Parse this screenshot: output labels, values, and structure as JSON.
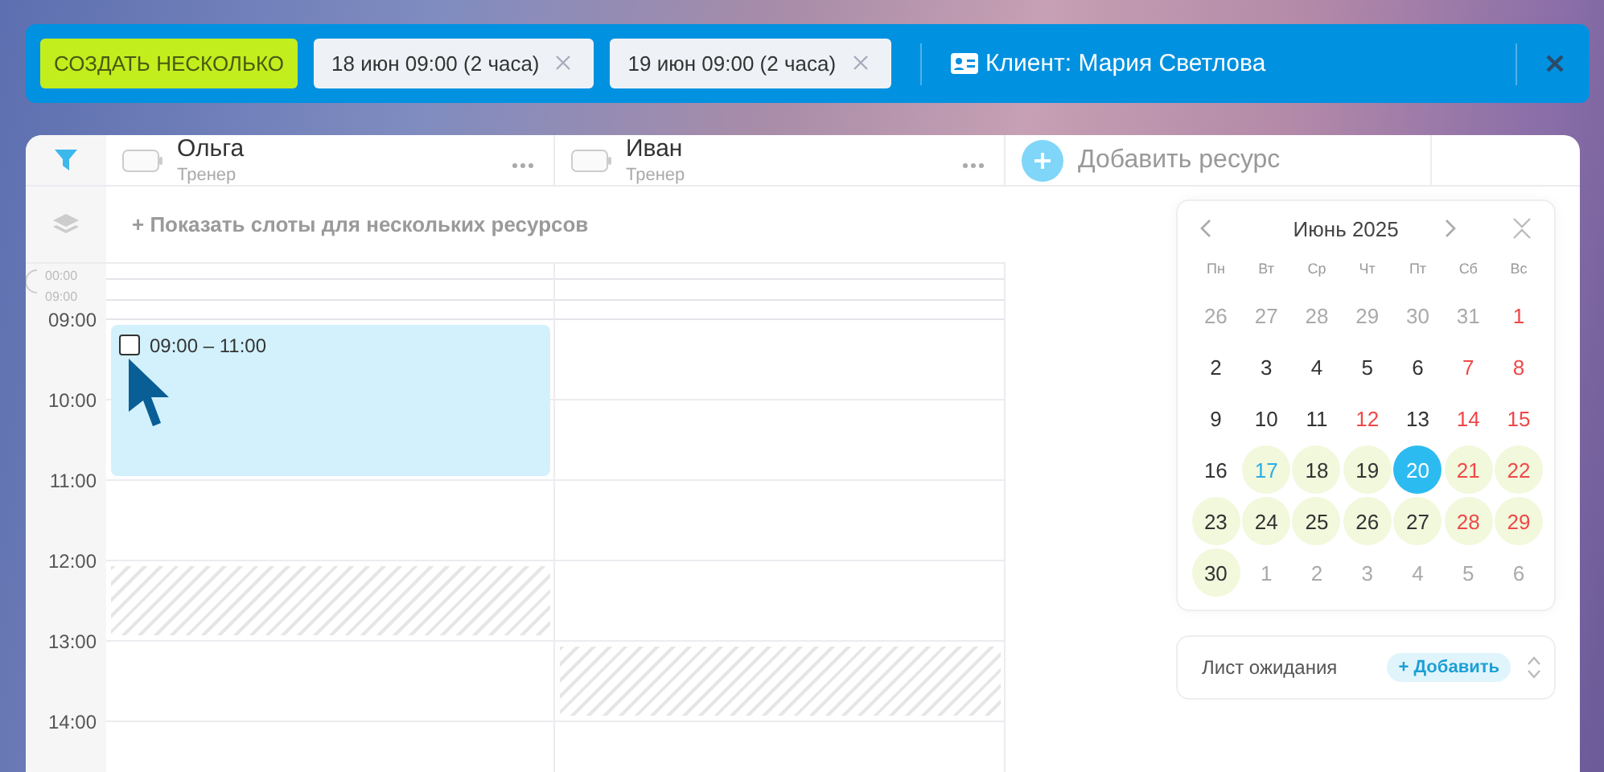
{
  "toolbar": {
    "create_button": "СОЗДАТЬ НЕСКОЛЬКО",
    "chips": [
      {
        "label": "18 июн 09:00 (2 часа)"
      },
      {
        "label": "19 июн 09:00 (2 часа)"
      }
    ],
    "client": "Клиент: Мария Светлова"
  },
  "resources": [
    {
      "name": "Ольга",
      "role": "Тренер",
      "event": {
        "time": "09:00 – 11:00",
        "checked": false
      },
      "cells": [
        {
          "kind": "free"
        },
        {
          "kind": "free"
        },
        {
          "kind": "free"
        },
        {
          "kind": "blocked"
        },
        {
          "kind": "free"
        }
      ]
    },
    {
      "name": "Иван",
      "role": "Тренер",
      "cells": [
        {
          "kind": "free"
        },
        {
          "kind": "free"
        },
        {
          "kind": "free"
        },
        {
          "kind": "free"
        },
        {
          "kind": "blocked"
        }
      ]
    }
  ],
  "add_resource": "Добавить ресурс",
  "show_slots": "+ Показать слоты для нескольких ресурсов",
  "collapsed_range": [
    "00:00",
    "09:00"
  ],
  "hours": [
    "09:00",
    "10:00",
    "11:00",
    "12:00",
    "13:00",
    "14:00"
  ],
  "calendar": {
    "title": "Июнь 2025",
    "weekdays": [
      "Пн",
      "Вт",
      "Ср",
      "Чт",
      "Пт",
      "Сб",
      "Вс"
    ],
    "days": [
      {
        "label": "26",
        "kind": "outside",
        "available": false,
        "selected": false
      },
      {
        "label": "27",
        "kind": "outside",
        "available": false,
        "selected": false
      },
      {
        "label": "28",
        "kind": "outside",
        "available": false,
        "selected": false
      },
      {
        "label": "29",
        "kind": "outside",
        "available": false,
        "selected": false
      },
      {
        "label": "30",
        "kind": "outside",
        "available": false,
        "selected": false
      },
      {
        "label": "31",
        "kind": "outside",
        "available": false,
        "selected": false
      },
      {
        "label": "1",
        "kind": "weekend",
        "available": false,
        "selected": false
      },
      {
        "label": "2",
        "kind": "normal",
        "available": false,
        "selected": false
      },
      {
        "label": "3",
        "kind": "normal",
        "available": false,
        "selected": false
      },
      {
        "label": "4",
        "kind": "normal",
        "available": false,
        "selected": false
      },
      {
        "label": "5",
        "kind": "normal",
        "available": false,
        "selected": false
      },
      {
        "label": "6",
        "kind": "normal",
        "available": false,
        "selected": false
      },
      {
        "label": "7",
        "kind": "weekend",
        "available": false,
        "selected": false
      },
      {
        "label": "8",
        "kind": "weekend",
        "available": false,
        "selected": false
      },
      {
        "label": "9",
        "kind": "normal",
        "available": false,
        "selected": false
      },
      {
        "label": "10",
        "kind": "normal",
        "available": false,
        "selected": false
      },
      {
        "label": "11",
        "kind": "normal",
        "available": false,
        "selected": false
      },
      {
        "label": "12",
        "kind": "weekend",
        "available": false,
        "selected": false
      },
      {
        "label": "13",
        "kind": "normal",
        "available": false,
        "selected": false
      },
      {
        "label": "14",
        "kind": "weekend",
        "available": false,
        "selected": false
      },
      {
        "label": "15",
        "kind": "weekend",
        "available": false,
        "selected": false
      },
      {
        "label": "16",
        "kind": "normal",
        "available": false,
        "selected": false
      },
      {
        "label": "17",
        "kind": "today",
        "available": true,
        "selected": false
      },
      {
        "label": "18",
        "kind": "normal",
        "available": true,
        "selected": false
      },
      {
        "label": "19",
        "kind": "normal",
        "available": true,
        "selected": false
      },
      {
        "label": "20",
        "kind": "normal",
        "available": true,
        "selected": true
      },
      {
        "label": "21",
        "kind": "weekend",
        "available": true,
        "selected": false
      },
      {
        "label": "22",
        "kind": "weekend",
        "available": true,
        "selected": false
      },
      {
        "label": "23",
        "kind": "normal",
        "available": true,
        "selected": false
      },
      {
        "label": "24",
        "kind": "normal",
        "available": true,
        "selected": false
      },
      {
        "label": "25",
        "kind": "normal",
        "available": true,
        "selected": false
      },
      {
        "label": "26",
        "kind": "normal",
        "available": true,
        "selected": false
      },
      {
        "label": "27",
        "kind": "normal",
        "available": true,
        "selected": false
      },
      {
        "label": "28",
        "kind": "weekend",
        "available": true,
        "selected": false
      },
      {
        "label": "29",
        "kind": "weekend",
        "available": true,
        "selected": false
      },
      {
        "label": "30",
        "kind": "normal",
        "available": true,
        "selected": false
      },
      {
        "label": "1",
        "kind": "outside",
        "available": false,
        "selected": false
      },
      {
        "label": "2",
        "kind": "outside",
        "available": false,
        "selected": false
      },
      {
        "label": "3",
        "kind": "outside",
        "available": false,
        "selected": false
      },
      {
        "label": "4",
        "kind": "outside",
        "available": false,
        "selected": false
      },
      {
        "label": "5",
        "kind": "outside",
        "available": false,
        "selected": false
      },
      {
        "label": "6",
        "kind": "outside",
        "available": false,
        "selected": false
      }
    ]
  },
  "waitlist": {
    "label": "Лист ожидания",
    "add_button": "+ Добавить"
  }
}
